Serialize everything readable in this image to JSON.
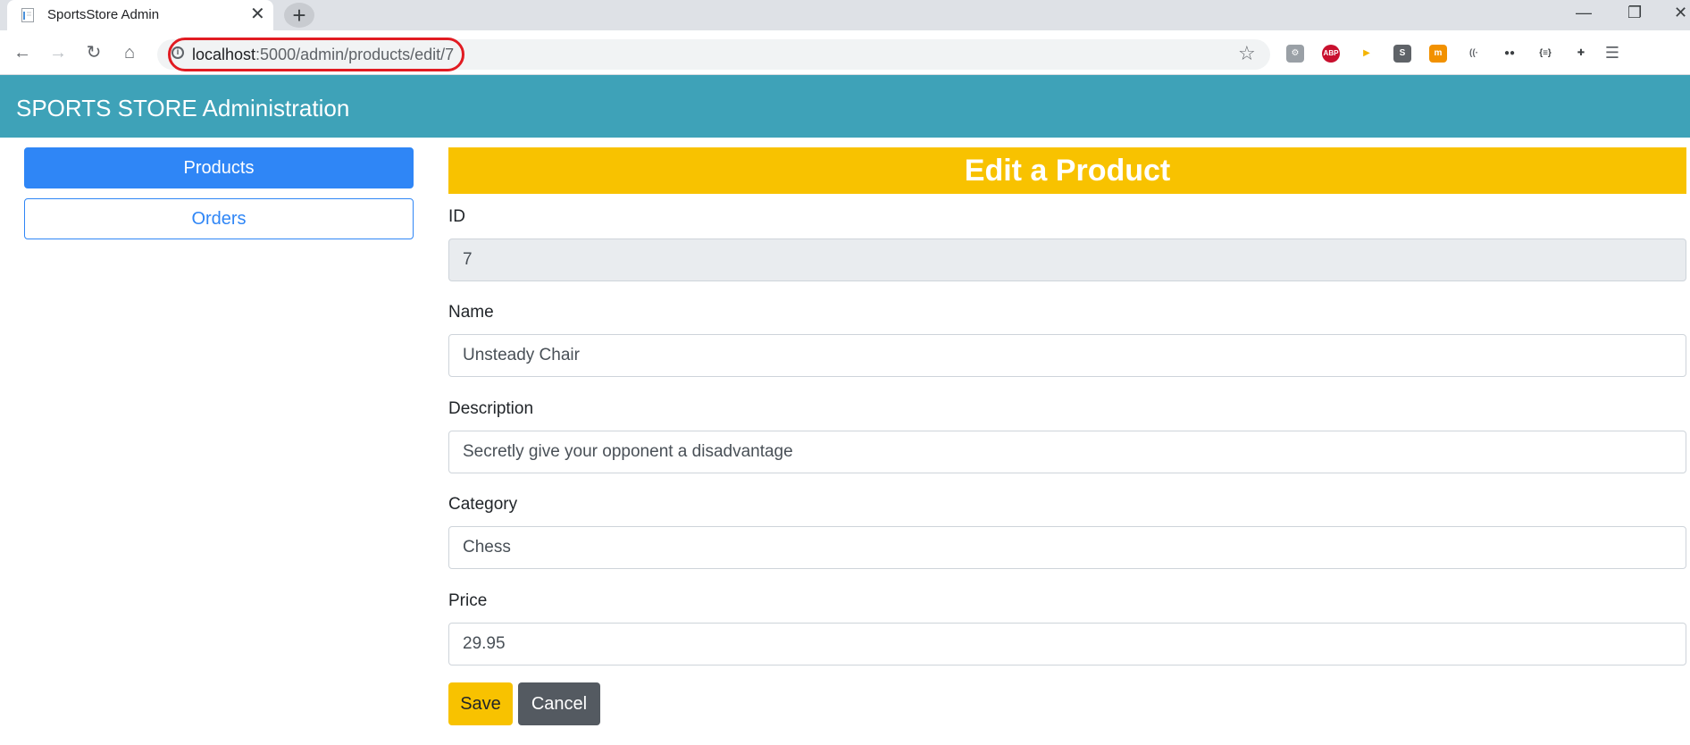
{
  "browser": {
    "tab_title": "SportsStore Admin",
    "tab_close": "✕",
    "new_tab": "+",
    "url_host": "localhost",
    "url_rest": ":5000/admin/products/edit/7",
    "extensions": [
      {
        "name": "settings-extension-icon",
        "color": "#9aa0a6",
        "glyph": "⚙"
      },
      {
        "name": "adblock-plus-icon",
        "color": "#c8102e",
        "glyph": "ABP"
      },
      {
        "name": "play-extension-icon",
        "color": "#ffffff",
        "glyph": "▶"
      },
      {
        "name": "s-extension-icon",
        "color": "#5f6368",
        "glyph": "S"
      },
      {
        "name": "m-extension-icon",
        "color": "#f29100",
        "glyph": "m"
      },
      {
        "name": "signal-extension-icon",
        "color": "#ffffff",
        "glyph": "((·"
      },
      {
        "name": "dots-extension-icon",
        "color": "#ffffff",
        "glyph": "●●"
      },
      {
        "name": "braces-extension-icon",
        "color": "#ffffff",
        "glyph": "{≡}"
      },
      {
        "name": "puzzle-extension-icon",
        "color": "#ffffff",
        "glyph": "✚"
      }
    ]
  },
  "app": {
    "title": "SPORTS STORE Administration"
  },
  "sidebar": {
    "items": [
      {
        "label": "Products",
        "active": true
      },
      {
        "label": "Orders",
        "active": false
      }
    ]
  },
  "form": {
    "heading": "Edit a Product",
    "fields": [
      {
        "label": "ID",
        "value": "7",
        "readonly": true
      },
      {
        "label": "Name",
        "value": "Unsteady Chair",
        "readonly": false
      },
      {
        "label": "Description",
        "value": "Secretly give your opponent a disadvantage",
        "readonly": false
      },
      {
        "label": "Category",
        "value": "Chess",
        "readonly": false
      },
      {
        "label": "Price",
        "value": "29.95",
        "readonly": false
      }
    ],
    "save_label": "Save",
    "cancel_label": "Cancel"
  },
  "colors": {
    "header": "#3ea2b8",
    "primary": "#2f86f6",
    "warning": "#f8c200",
    "secondary": "#545a61",
    "url_highlight": "#e11b22"
  }
}
